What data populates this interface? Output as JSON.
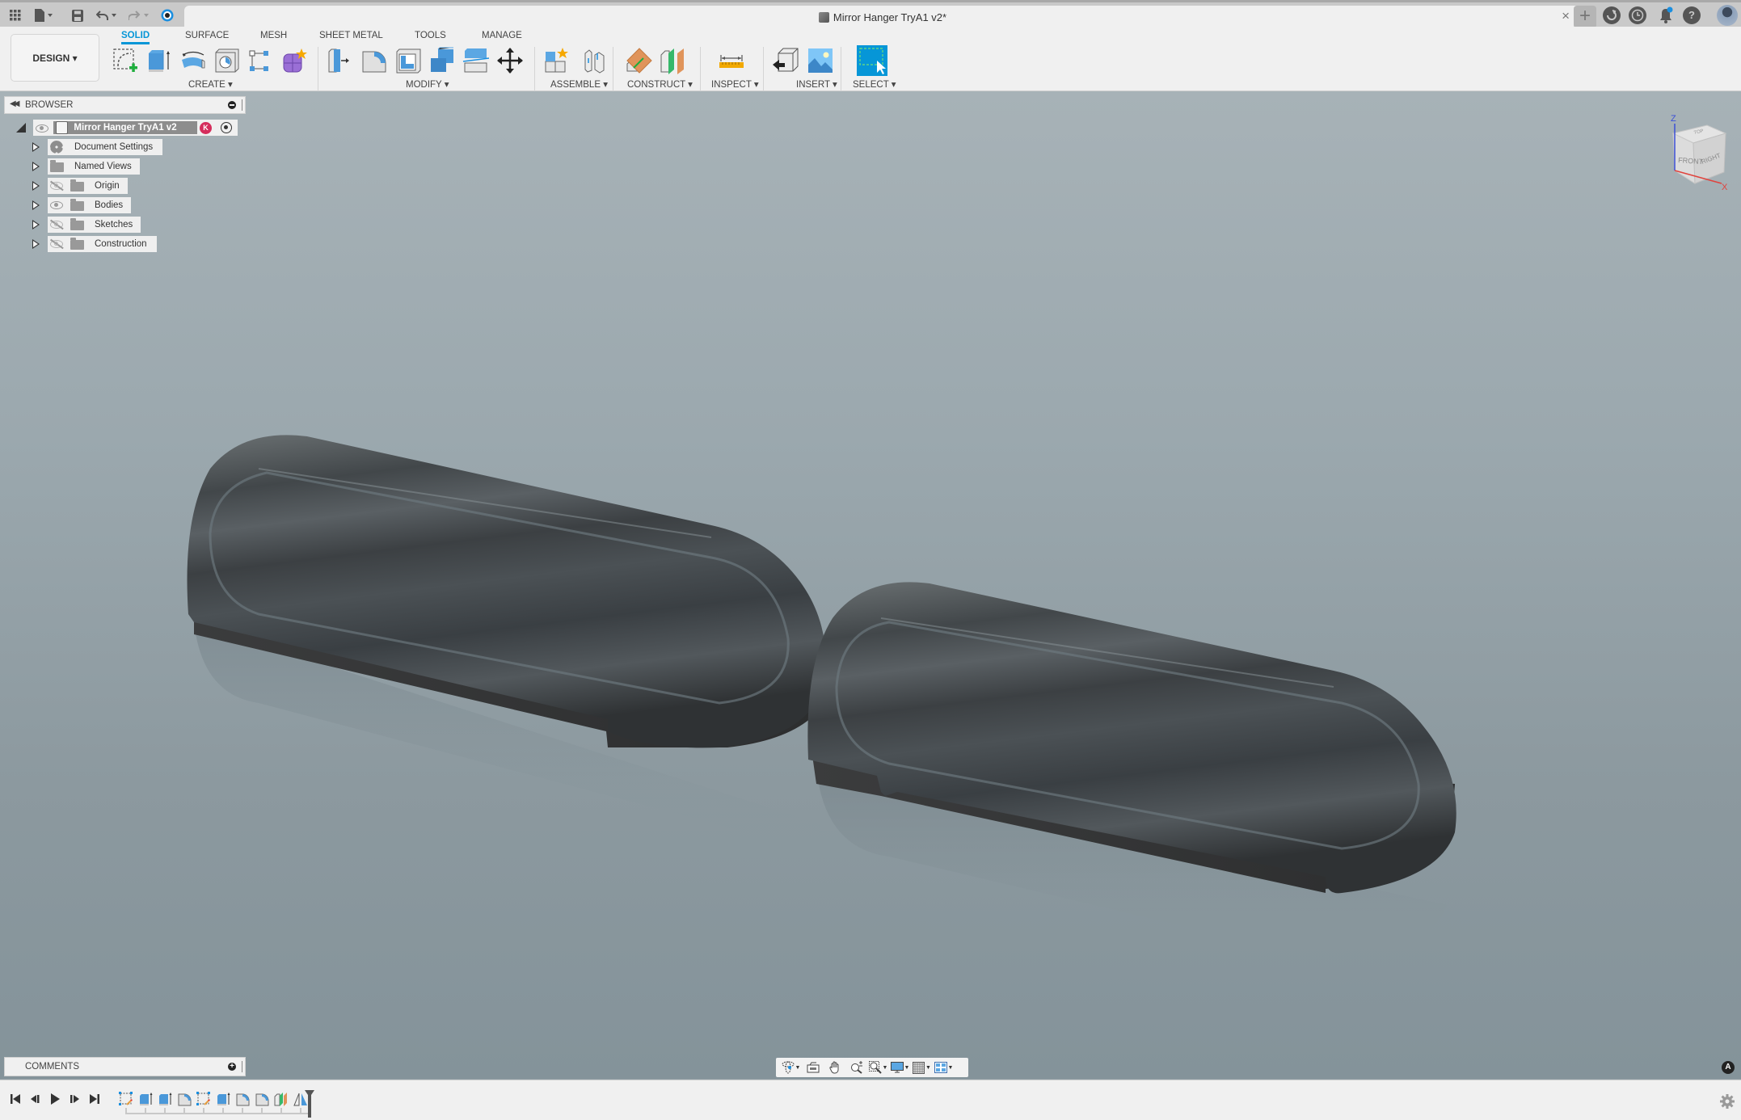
{
  "app": {
    "document_title": "Mirror Hanger TryA1 v2*",
    "workspace_button": "DESIGN ▾"
  },
  "quick_access": {
    "icons": [
      "apps-grid-icon",
      "file-icon",
      "save-icon",
      "undo-icon",
      "redo-icon",
      "job-status-icon"
    ]
  },
  "top_right": {
    "icons": [
      "new-tab-icon",
      "extensions-icon",
      "job-history-icon",
      "notifications-icon",
      "help-icon",
      "user-avatar"
    ],
    "help_glyph": "?"
  },
  "toolbar": {
    "tabs": [
      {
        "label": "SOLID",
        "active": true
      },
      {
        "label": "SURFACE",
        "active": false
      },
      {
        "label": "MESH",
        "active": false
      },
      {
        "label": "SHEET METAL",
        "active": false
      },
      {
        "label": "TOOLS",
        "active": false
      },
      {
        "label": "MANAGE",
        "active": false
      }
    ],
    "groups": [
      {
        "label": "CREATE ▾",
        "tools": [
          "create-sketch",
          "extrude",
          "revolve",
          "hole",
          "pattern",
          "create-form"
        ]
      },
      {
        "label": "MODIFY ▾",
        "tools": [
          "press-pull",
          "fillet",
          "shell",
          "combine",
          "split-body",
          "move-copy"
        ]
      },
      {
        "label": "ASSEMBLE ▾",
        "tools": [
          "new-component",
          "joint"
        ]
      },
      {
        "label": "CONSTRUCT ▾",
        "tools": [
          "plane-at-angle",
          "midplane"
        ]
      },
      {
        "label": "INSPECT ▾",
        "tools": [
          "measure"
        ]
      },
      {
        "label": "INSERT ▾",
        "tools": [
          "insert-derive",
          "canvas"
        ]
      },
      {
        "label": "SELECT ▾",
        "tools": [
          "window-select"
        ]
      }
    ],
    "accent_color": "#0696d7"
  },
  "browser": {
    "title": "BROWSER",
    "root": {
      "name": "Mirror Hanger TryA1 v2",
      "badge": "K",
      "badge_color": "#d52d5c"
    },
    "items": [
      {
        "label": "Document Settings",
        "icon": "gear",
        "visibility": "none"
      },
      {
        "label": "Named Views",
        "icon": "folder",
        "visibility": "none"
      },
      {
        "label": "Origin",
        "icon": "folder",
        "visibility": "hidden"
      },
      {
        "label": "Bodies",
        "icon": "folder",
        "visibility": "visible"
      },
      {
        "label": "Sketches",
        "icon": "folder",
        "visibility": "hidden"
      },
      {
        "label": "Construction",
        "icon": "folder",
        "visibility": "hidden"
      }
    ]
  },
  "viewcube": {
    "faces": [
      "FRONT",
      "RIGHT",
      "TOP"
    ],
    "axes": [
      "Z",
      "X"
    ],
    "axis_colors": {
      "z": "#3b4fd6",
      "x": "#e0433d"
    }
  },
  "viewport": {
    "bodies": [
      "mirror-hanger-body-1",
      "mirror-hanger-body-2"
    ]
  },
  "comments": {
    "title": "COMMENTS"
  },
  "navbar": {
    "tools": [
      "orbit",
      "look-at",
      "pan",
      "zoom",
      "fit",
      "display-settings",
      "grid-snaps",
      "viewports"
    ]
  },
  "timeline": {
    "playback": [
      "go-to-start",
      "step-back",
      "play",
      "step-forward",
      "go-to-end"
    ],
    "features": [
      "sketch",
      "extrude",
      "extrude",
      "fillet",
      "sketch",
      "extrude",
      "fillet",
      "fillet",
      "construction-plane",
      "mirror"
    ]
  }
}
